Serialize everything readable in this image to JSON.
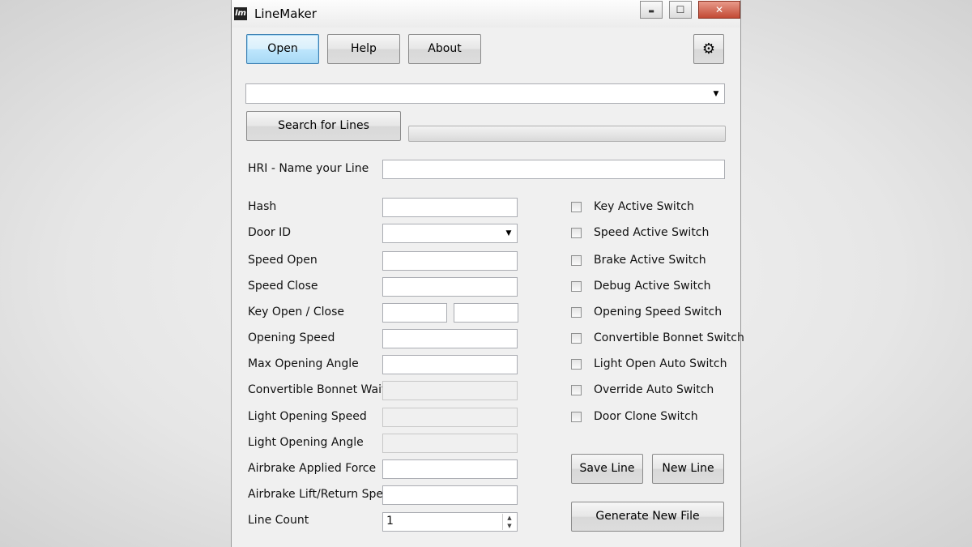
{
  "window": {
    "title": "LineMaker",
    "icon_text": "lm"
  },
  "window_controls": {
    "minimize": "▬",
    "maximize": "☐",
    "close": "✕"
  },
  "toolbar": {
    "open": "Open",
    "help": "Help",
    "about": "About",
    "settings_icon": "⚙"
  },
  "combo_main": {
    "value": ""
  },
  "search": {
    "button": "Search for Lines",
    "progress": 0
  },
  "hri": {
    "label": "HRI - Name your Line",
    "value": ""
  },
  "fields": {
    "hash": {
      "label": "Hash",
      "value": ""
    },
    "door_id": {
      "label": "Door ID",
      "value": ""
    },
    "speed_open": {
      "label": "Speed Open",
      "value": ""
    },
    "speed_close": {
      "label": "Speed Close",
      "value": ""
    },
    "key_open_close": {
      "label": "Key Open / Close",
      "value_open": "",
      "value_close": ""
    },
    "opening_speed": {
      "label": "Opening Speed",
      "value": ""
    },
    "max_opening_angle": {
      "label": "Max Opening Angle",
      "value": ""
    },
    "convertible_bonnet_wait": {
      "label": "Convertible Bonnet Wait",
      "value": ""
    },
    "light_opening_speed": {
      "label": "Light Opening Speed",
      "value": ""
    },
    "light_opening_angle": {
      "label": "Light Opening Angle",
      "value": ""
    },
    "airbrake_applied_force": {
      "label": "Airbrake Applied Force",
      "value": ""
    },
    "airbrake_lift_return_speed": {
      "label": "Airbrake Lift/Return Speed",
      "value": ""
    },
    "line_count": {
      "label": "Line Count",
      "value": "1"
    }
  },
  "switches": [
    {
      "label": "Key Active Switch",
      "checked": false
    },
    {
      "label": "Speed Active Switch",
      "checked": false
    },
    {
      "label": "Brake Active Switch",
      "checked": false
    },
    {
      "label": "Debug Active Switch",
      "checked": false
    },
    {
      "label": "Opening Speed Switch",
      "checked": false
    },
    {
      "label": "Convertible Bonnet Switch",
      "checked": false
    },
    {
      "label": "Light Open Auto Switch",
      "checked": false
    },
    {
      "label": "Override Auto Switch",
      "checked": false
    },
    {
      "label": "Door Clone Switch",
      "checked": false
    }
  ],
  "actions": {
    "save_line": "Save Line",
    "new_line": "New Line",
    "generate_new_file": "Generate New File"
  },
  "colors": {
    "focus_border": "#3c7fb1",
    "close_button": "#c24a35"
  }
}
